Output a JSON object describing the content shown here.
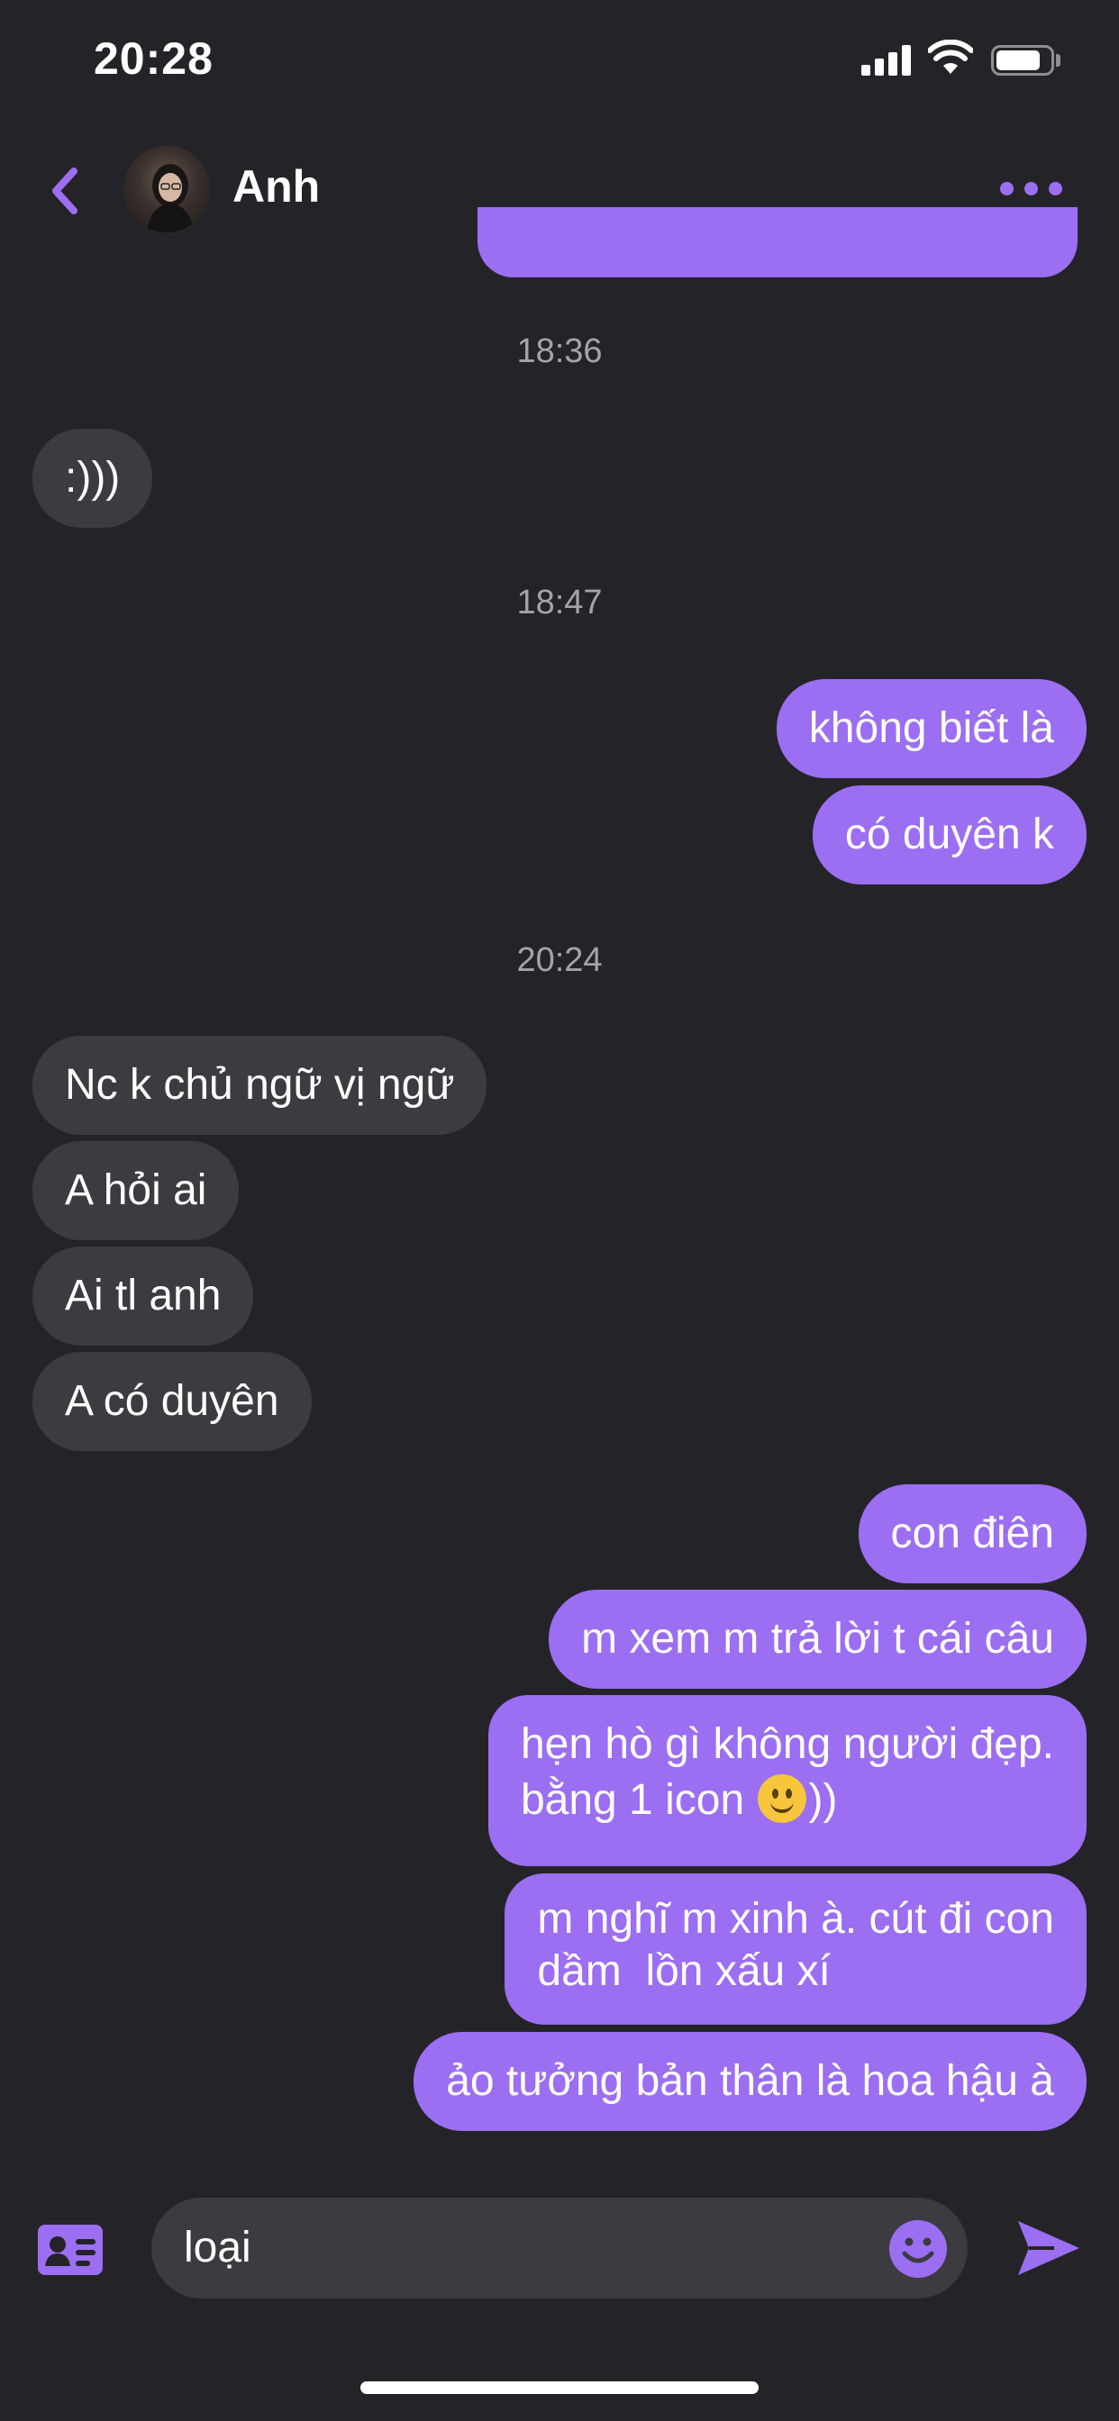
{
  "status_bar": {
    "time": "20:28"
  },
  "header": {
    "contact_name": "Anh"
  },
  "conversation": {
    "timestamps": [
      "18:36",
      "18:47",
      "20:24"
    ],
    "messages": [
      {
        "direction": "in",
        "text": ":)))"
      },
      {
        "direction": "out",
        "text": "không biết là"
      },
      {
        "direction": "out",
        "text": "có duyên k"
      },
      {
        "direction": "in",
        "text": "Nc k chủ ngữ vị ngữ"
      },
      {
        "direction": "in",
        "text": "A hỏi ai"
      },
      {
        "direction": "in",
        "text": "Ai tl anh"
      },
      {
        "direction": "in",
        "text": "A có duyên"
      },
      {
        "direction": "out",
        "text": "con điên"
      },
      {
        "direction": "out",
        "text": "m xem m trả lời t cái câu"
      },
      {
        "direction": "out",
        "line1": "hẹn hò gì không người đẹp.",
        "line2_before_emoji": "bằng 1 icon ",
        "emoji": "slightly-smiling-face",
        "line2_after_emoji": "))"
      },
      {
        "direction": "out",
        "line1": "m nghĩ m xinh à. cút đi con",
        "line2": "dầm  lồn xấu xí"
      },
      {
        "direction": "out",
        "text": "ảo tưởng bản thân là hoa hậu à"
      }
    ]
  },
  "composer": {
    "input_value": "loại"
  },
  "icons": {
    "back": "chevron-left-icon",
    "more": "more-horizontal-icon",
    "contact_card": "contact-card-icon",
    "emoji": "smile-icon",
    "send": "send-icon"
  },
  "colors": {
    "background": "#242428",
    "accent": "#9b6ef2",
    "incoming_bubble": "#3b3b40",
    "timestamp": "#a3a3a8"
  }
}
